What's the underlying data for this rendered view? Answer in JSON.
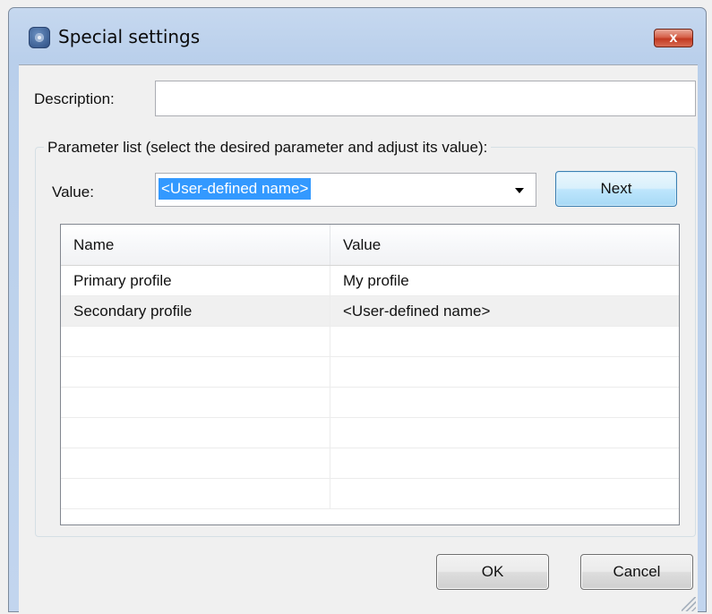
{
  "window": {
    "title": "Special settings",
    "close_label": "x"
  },
  "form": {
    "description_label": "Description:",
    "description_value": "",
    "group_label": "Parameter list (select the desired parameter and adjust its value):",
    "value_label": "Value:",
    "value_selected": "<User-defined name>",
    "next_label": "Next"
  },
  "table": {
    "headers": [
      "Name",
      "Value"
    ],
    "rows": [
      [
        "Primary profile",
        "My profile"
      ],
      [
        "Secondary profile",
        "<User-defined name>"
      ],
      [
        "",
        ""
      ],
      [
        "",
        ""
      ],
      [
        "",
        ""
      ],
      [
        "",
        ""
      ],
      [
        "",
        ""
      ],
      [
        "",
        ""
      ]
    ]
  },
  "buttons": {
    "ok_label": "OK",
    "cancel_label": "Cancel"
  },
  "colors": {
    "selection": "#3399ff",
    "title_bar": "#b9cfeb",
    "close_button": "#c23a22",
    "default_button": "#bee6fd"
  },
  "icons": {
    "app": "settings-app-icon",
    "close": "close-icon",
    "dropdown": "chevron-down-icon",
    "grip": "resize-grip-icon"
  }
}
